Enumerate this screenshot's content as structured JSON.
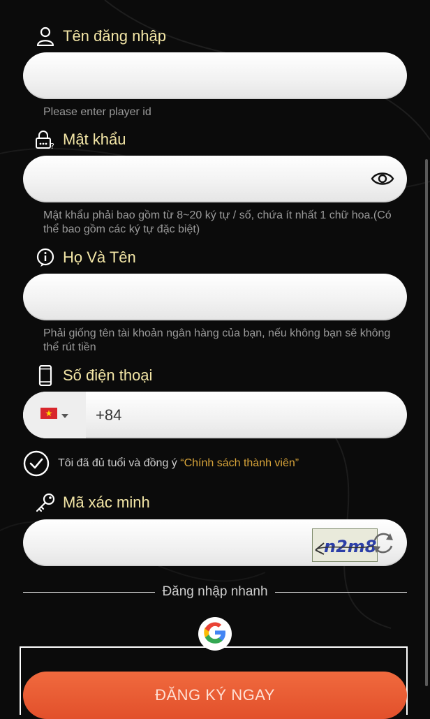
{
  "username": {
    "label": "Tên đăng nhập",
    "value": "",
    "hint": "Please enter player id"
  },
  "password": {
    "label": "Mật khẩu",
    "value": "",
    "hint": "Mật khẩu phải bao gồm từ 8~20 ký tự / số, chứa ít nhất 1 chữ hoa.(Có thể bao gồm các ký tự đặc biệt)"
  },
  "fullname": {
    "label": "Họ Và Tên",
    "value": "",
    "hint": "Phải giống tên tài khoản ngân hàng của bạn, nếu không bạn sẽ không thể rút tiền"
  },
  "phone": {
    "label": "Số điện thoại",
    "country_code": "+84",
    "value": ""
  },
  "agreement": {
    "text": "Tôi đã đủ tuổi và đồng ý",
    "link": "“Chính sách thành viên”",
    "checked": true
  },
  "captcha": {
    "label": "Mã xác minh",
    "value": "",
    "image_text": "n2m8"
  },
  "quick_login": {
    "label": "Đăng nhập nhanh"
  },
  "register_button": {
    "label": "ĐĂNG KÝ NGAY"
  },
  "colors": {
    "label": "#f3e6a6",
    "hint": "#9a9a9a",
    "link": "#d9a53a",
    "button": "#e85c33",
    "background": "#0b0b0b"
  },
  "icons": {
    "username": "user-icon",
    "password": "lock-icon",
    "fullname": "info-icon",
    "phone": "phone-icon",
    "captcha": "key-icon",
    "show_password": "eye-icon",
    "refresh": "refresh-icon",
    "flag": "vietnam-flag-icon",
    "google": "google-icon"
  }
}
